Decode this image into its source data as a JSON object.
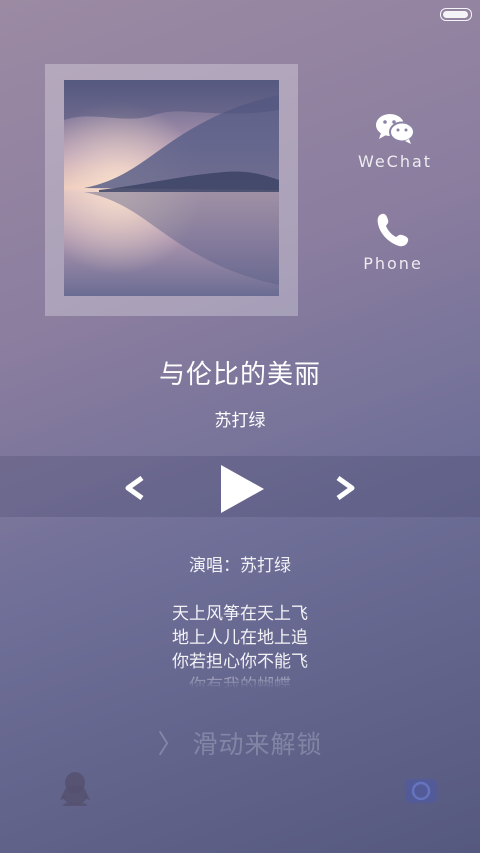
{
  "status_bar": {
    "battery_level": 0.95
  },
  "album": {
    "art": "misty-lake-mountain-landscape"
  },
  "side_actions": [
    {
      "label": "WeChat",
      "icon": "wechat-icon"
    },
    {
      "label": "Phone",
      "icon": "phone-icon"
    }
  ],
  "song": {
    "title": "与伦比的美丽",
    "artist": "苏打绿",
    "singer_line": "演唱：苏打绿"
  },
  "controls": {
    "prev_icon": "chevron-left-icon",
    "play_icon": "play-icon",
    "next_icon": "chevron-right-icon"
  },
  "lyrics": [
    "天上风筝在天上飞",
    "地上人儿在地上追",
    "你若担心你不能飞",
    "你有我的蝴蝶"
  ],
  "unlock": {
    "chevron": "〉",
    "label": "滑动来解锁"
  },
  "corners": {
    "left_icon": "qq-penguin-icon",
    "right_icon": "camera-icon"
  },
  "colors": {
    "background_top": "#9c8aa3",
    "background_bottom": "#55587f",
    "text": "#ffffff"
  }
}
